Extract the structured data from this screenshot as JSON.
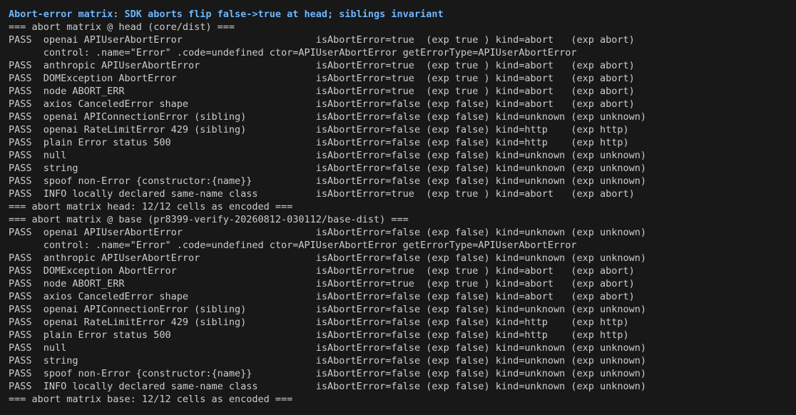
{
  "terminal": {
    "title": "Abort-error matrix: SDK aborts flip false->true at head; siblings invariant",
    "lines": [
      "=== abort matrix @ head (core/dist) ===",
      "PASS  openai APIUserAbortError                       isAbortError=true  (exp true ) kind=abort   (exp abort)",
      "      control: .name=\"Error\" .code=undefined ctor=APIUserAbortError getErrorType=APIUserAbortError",
      "PASS  anthropic APIUserAbortError                    isAbortError=true  (exp true ) kind=abort   (exp abort)",
      "PASS  DOMException AbortError                        isAbortError=true  (exp true ) kind=abort   (exp abort)",
      "PASS  node ABORT_ERR                                 isAbortError=true  (exp true ) kind=abort   (exp abort)",
      "PASS  axios CanceledError shape                      isAbortError=false (exp false) kind=abort   (exp abort)",
      "PASS  openai APIConnectionError (sibling)            isAbortError=false (exp false) kind=unknown (exp unknown)",
      "PASS  openai RateLimitError 429 (sibling)            isAbortError=false (exp false) kind=http    (exp http)",
      "PASS  plain Error status 500                         isAbortError=false (exp false) kind=http    (exp http)",
      "PASS  null                                           isAbortError=false (exp false) kind=unknown (exp unknown)",
      "PASS  string                                         isAbortError=false (exp false) kind=unknown (exp unknown)",
      "PASS  spoof non-Error {constructor:{name}}           isAbortError=false (exp false) kind=unknown (exp unknown)",
      "PASS  INFO locally declared same-name class          isAbortError=true  (exp true ) kind=abort   (exp abort)",
      "=== abort matrix head: 12/12 cells as encoded ===",
      "=== abort matrix @ base (pr8399-verify-20260812-030112/base-dist) ===",
      "PASS  openai APIUserAbortError                       isAbortError=false (exp false) kind=unknown (exp unknown)",
      "      control: .name=\"Error\" .code=undefined ctor=APIUserAbortError getErrorType=APIUserAbortError",
      "PASS  anthropic APIUserAbortError                    isAbortError=false (exp false) kind=unknown (exp unknown)",
      "PASS  DOMException AbortError                        isAbortError=true  (exp true ) kind=abort   (exp abort)",
      "PASS  node ABORT_ERR                                 isAbortError=true  (exp true ) kind=abort   (exp abort)",
      "PASS  axios CanceledError shape                      isAbortError=false (exp false) kind=abort   (exp abort)",
      "PASS  openai APIConnectionError (sibling)            isAbortError=false (exp false) kind=unknown (exp unknown)",
      "PASS  openai RateLimitError 429 (sibling)            isAbortError=false (exp false) kind=http    (exp http)",
      "PASS  plain Error status 500                         isAbortError=false (exp false) kind=http    (exp http)",
      "PASS  null                                           isAbortError=false (exp false) kind=unknown (exp unknown)",
      "PASS  string                                         isAbortError=false (exp false) kind=unknown (exp unknown)",
      "PASS  spoof non-Error {constructor:{name}}           isAbortError=false (exp false) kind=unknown (exp unknown)",
      "PASS  INFO locally declared same-name class          isAbortError=false (exp false) kind=unknown (exp unknown)",
      "=== abort matrix base: 12/12 cells as encoded ==="
    ]
  },
  "colors": {
    "background": "#181818",
    "text": "#cccccc",
    "title": "#6cb6ff"
  }
}
